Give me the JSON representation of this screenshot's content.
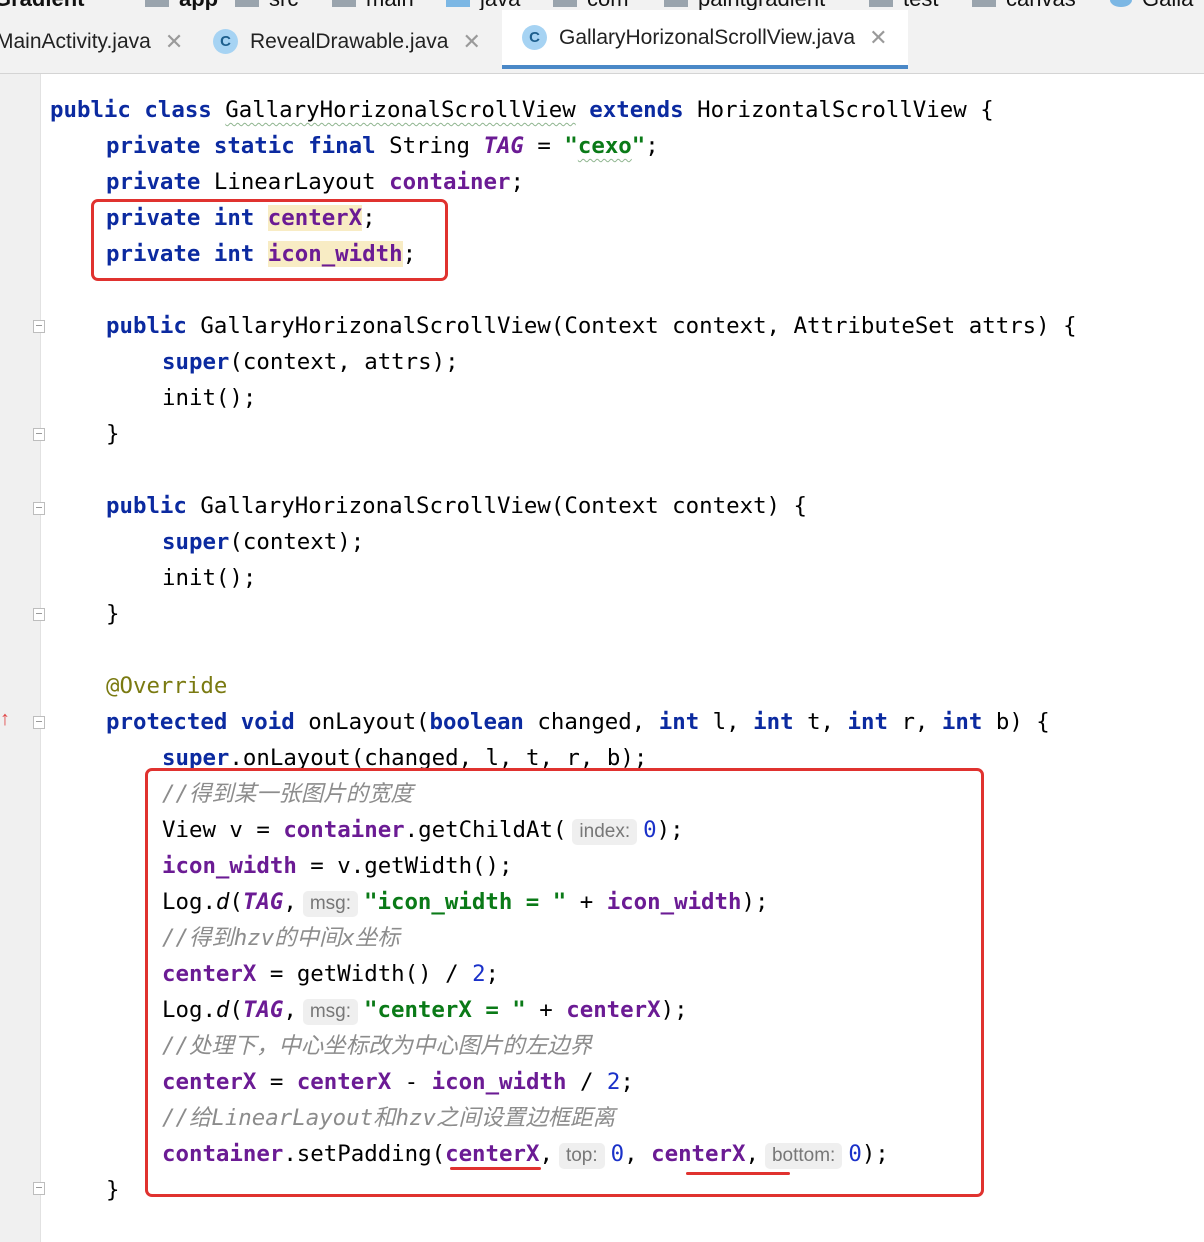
{
  "breadcrumbs": [
    {
      "label": "Gradient",
      "icon": "none"
    },
    {
      "label": "app",
      "icon": "module-folder-icon"
    },
    {
      "label": "src",
      "icon": "folder-icon"
    },
    {
      "label": "main",
      "icon": "folder-icon"
    },
    {
      "label": "java",
      "icon": "source-folder-icon"
    },
    {
      "label": "com",
      "icon": "package-icon"
    },
    {
      "label": "paintgradient",
      "icon": "package-icon"
    },
    {
      "label": "test",
      "icon": "package-icon"
    },
    {
      "label": "canvas",
      "icon": "package-icon"
    },
    {
      "label": "Galla",
      "icon": "class-icon"
    }
  ],
  "tabs": [
    {
      "label": "MainActivity.java",
      "active": false
    },
    {
      "label": "RevealDrawable.java",
      "active": false
    },
    {
      "label": "GallaryHorizonalScrollView.java",
      "active": true
    }
  ],
  "tab_icon_letter": "C",
  "close_glyph": "✕",
  "code": {
    "l1": {
      "kw1": "public",
      "kw2": "class",
      "cls": "GallaryHorizonalScrollView",
      "kw3": "extends",
      "rest": "HorizontalScrollView {"
    },
    "l2": {
      "kw": "private static final",
      "type": "String",
      "tag": "TAG",
      "eq": " = ",
      "str_q1": "\"",
      "str": "cexo",
      "str_q2": "\"",
      "end": ";"
    },
    "l3": {
      "kw": "private",
      "type": "LinearLayout",
      "fld": "container",
      "end": ";"
    },
    "l4": {
      "kw": "private int",
      "fld": "centerX",
      "end": ";"
    },
    "l5": {
      "kw": "private int",
      "fld": "icon_width",
      "end": ";"
    },
    "l6": {
      "kw": "public",
      "rest": "GallaryHorizonalScrollView(Context context, AttributeSet attrs) {"
    },
    "l7": {
      "kw": "super",
      "rest": "(context, attrs);"
    },
    "l8": "init();",
    "l9": "}",
    "l10": {
      "kw": "public",
      "rest": "GallaryHorizonalScrollView(Context context) {"
    },
    "l11": {
      "kw": "super",
      "rest": "(context);"
    },
    "l12": "init();",
    "l13": "}",
    "l14": "@Override",
    "l15": {
      "kw1": "protected void",
      "name": "onLayout(",
      "kw2": "boolean",
      "p1": "changed, ",
      "kw3": "int",
      "p2": "l, ",
      "kw4": "int",
      "p3": "t, ",
      "kw5": "int",
      "p4": "r, ",
      "kw6": "int",
      "p5": "b) {"
    },
    "l16": {
      "kw": "super",
      "rest": ".onLayout(changed, l, t, r, b);"
    },
    "l17": "//得到某一张图片的宽度",
    "l18": {
      "a": "View v = ",
      "fld": "container",
      "b": ".getChildAt(",
      "hint": "index:",
      "num": "0",
      "c": ");"
    },
    "l19": {
      "fld": "icon_width",
      "rest": " = v.getWidth();"
    },
    "l20": {
      "a": "Log.",
      "d": "d",
      "b": "(",
      "tag": "TAG",
      "c": ",",
      "hint": "msg:",
      "str": "\"icon_width = \"",
      "plus": " + ",
      "fld": "icon_width",
      "end": ");"
    },
    "l21": "//得到hzv的中间x坐标",
    "l22": {
      "fld": "centerX",
      "a": " = getWidth() / ",
      "num": "2",
      "end": ";"
    },
    "l23": {
      "a": "Log.",
      "d": "d",
      "b": "(",
      "tag": "TAG",
      "c": ",",
      "hint": "msg:",
      "str": "\"centerX = \"",
      "plus": " + ",
      "fld": "centerX",
      "end": ");"
    },
    "l24": "//处理下，中心坐标改为中心图片的左边界",
    "l25": {
      "fld1": "centerX",
      "eq": " = ",
      "fld2": "centerX",
      "minus": " - ",
      "fld3": "icon_width",
      "div": " / ",
      "num": "2",
      "end": ";"
    },
    "l26": "//给LinearLayout和hzv之间设置边框距离",
    "l27": {
      "fld": "container",
      "a": ".setPadding(",
      "f1": "centerX",
      "c1": ",",
      "h1": "top:",
      "n1": "0",
      "c2": ", ",
      "f2": "centerX",
      "c3": ",",
      "h2": "bottom:",
      "n2": "0",
      "end": ");"
    },
    "l28": "}"
  }
}
